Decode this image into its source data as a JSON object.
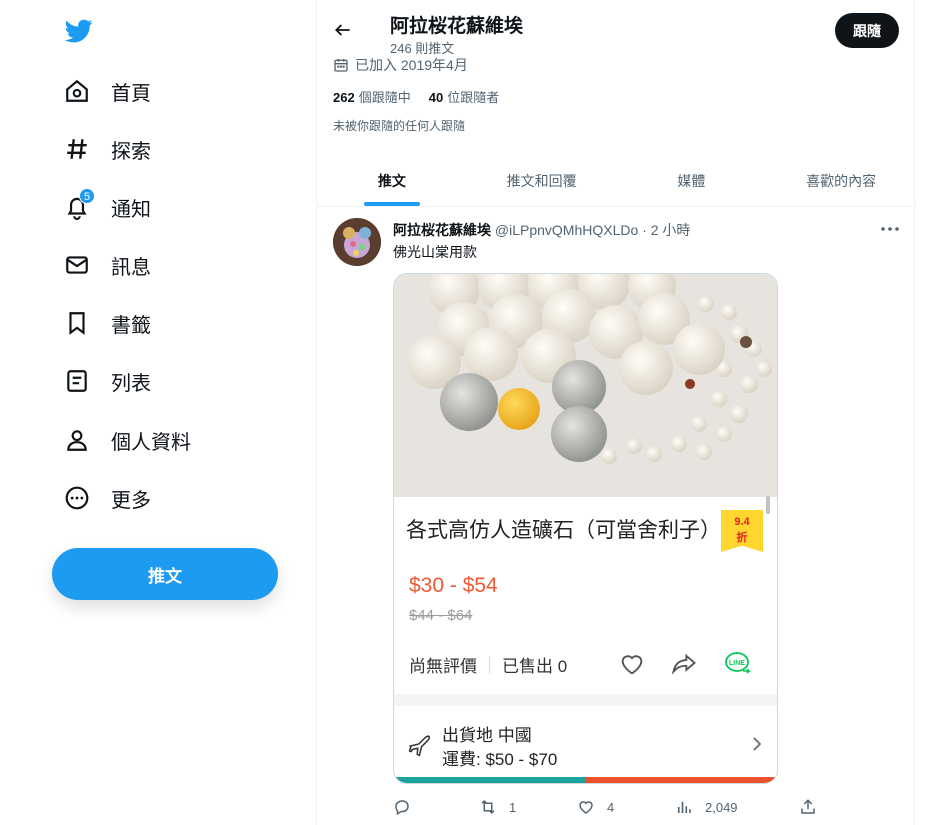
{
  "sidebar": {
    "logo": "twitter-bird-icon",
    "items": [
      {
        "label": "首頁",
        "icon": "home-icon"
      },
      {
        "label": "探索",
        "icon": "hashtag-icon"
      },
      {
        "label": "通知",
        "icon": "bell-icon",
        "badge": "5"
      },
      {
        "label": "訊息",
        "icon": "mail-icon"
      },
      {
        "label": "書籤",
        "icon": "bookmark-icon"
      },
      {
        "label": "列表",
        "icon": "list-icon"
      },
      {
        "label": "個人資料",
        "icon": "profile-icon"
      },
      {
        "label": "更多",
        "icon": "more-circle-icon"
      }
    ],
    "tweet_button": "推文"
  },
  "profile": {
    "name": "阿拉桜花蘇維埃",
    "tweet_count": "246 則推文",
    "follow_button": "跟隨",
    "joined": "已加入 2019年4月",
    "following_count": "262",
    "following_label": "個跟隨中",
    "followers_count": "40",
    "followers_label": "位跟隨者",
    "not_followed": "未被你跟隨的任何人跟隨"
  },
  "tabs": [
    {
      "label": "推文",
      "active": true
    },
    {
      "label": "推文和回覆",
      "active": false
    },
    {
      "label": "媒體",
      "active": false
    },
    {
      "label": "喜歡的內容",
      "active": false
    }
  ],
  "tweet": {
    "author": "阿拉桜花蘇維埃",
    "handle": "@iLPpnvQMhHQXLDo",
    "time": "· 2 小時",
    "text": "佛光山棠用款",
    "card": {
      "title": "各式高仿人造礦石（可當舍利子）",
      "discount_value": "9.4",
      "discount_unit": "折",
      "price": "$30 - $54",
      "original_price": "$44 - $64",
      "rating": "尚無評價",
      "sold": "已售出 0",
      "ship_origin": "出貨地 中國",
      "ship_fee": "運費: $50 - $70"
    },
    "actions": {
      "reply": "",
      "retweet": "1",
      "like": "4",
      "views": "2,049"
    }
  },
  "colors": {
    "accent": "#1d9bf0",
    "price": "#ef5a34",
    "line_green": "#06c755"
  }
}
